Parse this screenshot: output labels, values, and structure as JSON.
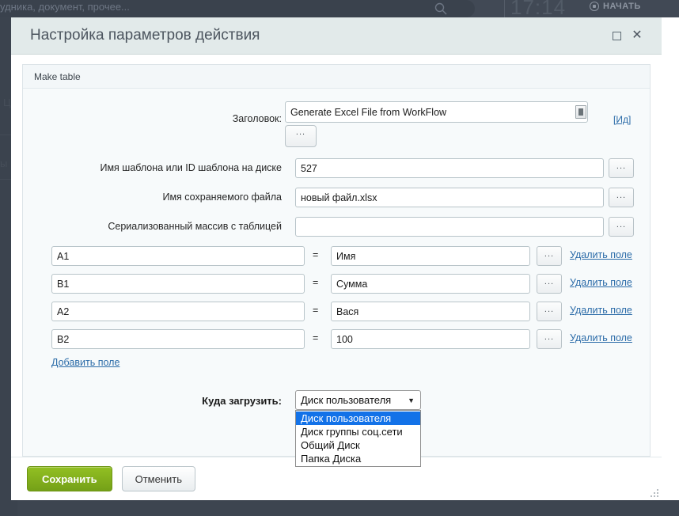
{
  "background": {
    "search_placeholder": "удника, документ, прочее...",
    "search_icon": "search-icon",
    "timer": "17:14",
    "start_label": "НАЧАТЬ",
    "record_icon": "record-icon",
    "ghost_texts": [
      "Ц",
      "ы Ш"
    ]
  },
  "dialog": {
    "title": "Настройка параметров действия",
    "maximize_icon": "maximize-icon",
    "close_icon": "close-icon",
    "panel_header": "Make table",
    "title_field": {
      "label": "Заголовок:",
      "value": "Generate Excel File from WorkFlow",
      "placeholder": "",
      "dots_label": "...",
      "grip_icon": "textarea-grip-icon",
      "id_link": "[Ид]"
    },
    "fields": [
      {
        "label": "Имя шаблона или ID шаблона на диске",
        "value": "527",
        "placeholder": "",
        "dots_label": "..."
      },
      {
        "label": "Имя сохраняемого файла",
        "value": "новый файл.xlsx",
        "placeholder": "",
        "dots_label": "..."
      },
      {
        "label": "Сериализованный массив с таблицей",
        "value": "",
        "placeholder": "",
        "dots_label": "..."
      }
    ],
    "key_value_rows": [
      {
        "key": "A1",
        "eq": "=",
        "value": "Имя",
        "dots_label": "...",
        "remove_label": "Удалить поле"
      },
      {
        "key": "B1",
        "eq": "=",
        "value": "Сумма",
        "dots_label": "...",
        "remove_label": "Удалить поле"
      },
      {
        "key": "A2",
        "eq": "=",
        "value": "Вася",
        "dots_label": "...",
        "remove_label": "Удалить поле"
      },
      {
        "key": "B2",
        "eq": "=",
        "value": "100",
        "dots_label": "...",
        "remove_label": "Удалить поле"
      }
    ],
    "add_field_label": "Добавить поле",
    "upload_select": {
      "label": "Куда загрузить:",
      "selected": "Диск пользователя",
      "caret_icon": "chevron-down-icon",
      "options": [
        "Диск пользователя",
        "Диск группы соц.сети",
        "Общий Диск",
        "Папка Диска"
      ],
      "highlighted_index": 0
    },
    "footer": {
      "save_label": "Сохранить",
      "cancel_label": "Отменить"
    },
    "resize_handle_icon": "resize-grip-icon"
  },
  "colors": {
    "accent_save": "#7ba81a",
    "link": "#2b6ba8",
    "titlebar": "#e2eaea",
    "select_highlight": "#1372e8",
    "backdrop": "#3d4550"
  }
}
